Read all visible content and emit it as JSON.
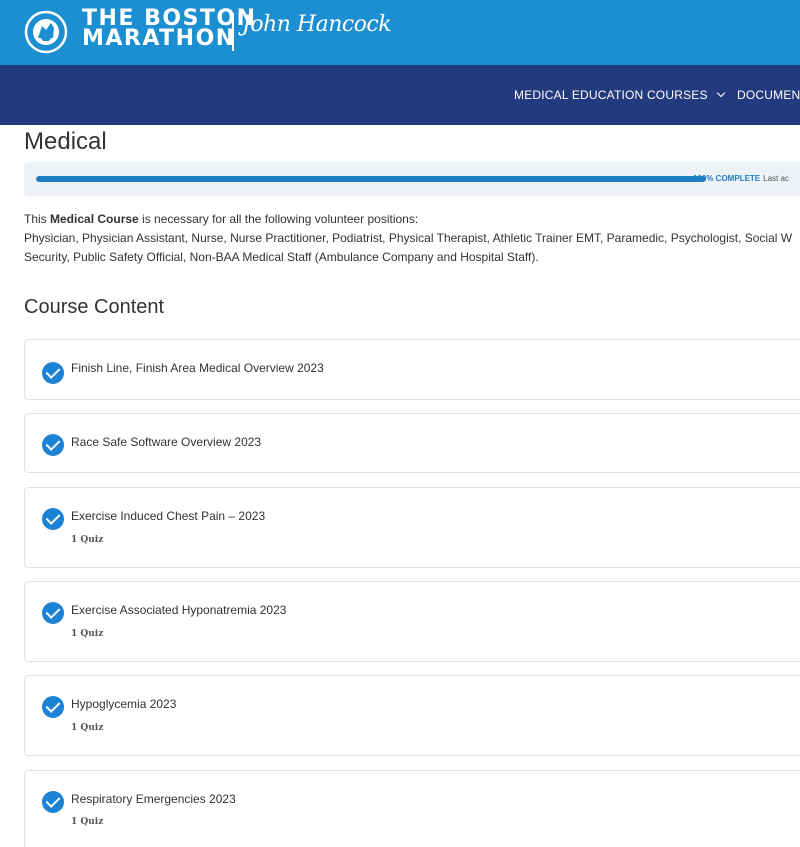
{
  "header": {
    "brand_line1": "THE BOSTON",
    "brand_line2": "MARATHON",
    "sponsor": "John Hancock",
    "seal_alt": "boston-athletic-association-seal"
  },
  "nav": {
    "items": [
      {
        "label": "MEDICAL EDUCATION COURSES",
        "has_dropdown": true,
        "icon": "chevron-down-icon"
      },
      {
        "label": "DOCUMENT"
      }
    ]
  },
  "course": {
    "title": "Medical",
    "progress": {
      "percent": 100,
      "label": "100% COMPLETE",
      "last_activity_label": "Last ac"
    },
    "intro_prefix": "This ",
    "intro_bold": "Medical Course",
    "intro_suffix": " is necessary for all the following volunteer positions:",
    "positions_line1": "Physician, Physician Assistant, Nurse, Nurse Practitioner, Podiatrist, Physical Therapist, Athletic Trainer EMT, Paramedic, Psychologist, Social W",
    "positions_line2": "Security, Public Safety Official, Non-BAA Medical Staff (Ambulance Company and Hospital Staff)."
  },
  "content": {
    "heading": "Course Content",
    "lessons": [
      {
        "title": "Finish Line, Finish Area Medical Overview 2023",
        "status": "complete",
        "quiz": ""
      },
      {
        "title": "Race Safe Software Overview 2023",
        "status": "complete",
        "quiz": ""
      },
      {
        "title": "Exercise Induced Chest Pain – 2023",
        "status": "complete",
        "quiz": "1 Quiz"
      },
      {
        "title": "Exercise Associated Hyponatremia 2023",
        "status": "complete",
        "quiz": "1 Quiz"
      },
      {
        "title": "Hypoglycemia 2023",
        "status": "complete",
        "quiz": "1 Quiz"
      },
      {
        "title": "Respiratory Emergencies 2023",
        "status": "complete",
        "quiz": "1 Quiz"
      }
    ]
  },
  "colors": {
    "brand_blue": "#1b8fd1",
    "nav_navy": "#243a7f",
    "progress_blue": "#1b7fc4",
    "check_blue": "#1b83d6"
  }
}
